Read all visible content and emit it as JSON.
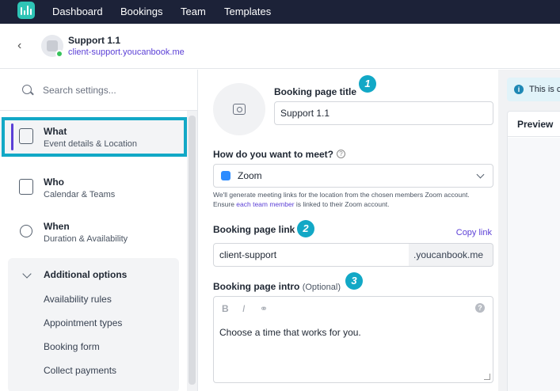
{
  "nav": {
    "items": [
      {
        "label": "Dashboard"
      },
      {
        "label": "Bookings"
      },
      {
        "label": "Team"
      },
      {
        "label": "Templates"
      }
    ]
  },
  "page": {
    "name": "Support 1.1",
    "url": "client-support.youcanbook.me"
  },
  "sidebar": {
    "search_placeholder": "Search settings...",
    "items": [
      {
        "title": "What",
        "subtitle": "Event details & Location",
        "icon": "details-icon",
        "active": true
      },
      {
        "title": "Who",
        "subtitle": "Calendar & Teams",
        "icon": "calendar-icon"
      },
      {
        "title": "When",
        "subtitle": "Duration & Availability",
        "icon": "watch-icon"
      }
    ],
    "additional": {
      "title": "Additional options",
      "items": [
        "Availability rules",
        "Appointment types",
        "Booking form",
        "Collect payments"
      ]
    }
  },
  "form": {
    "title_label": "Booking page title",
    "title_value": "Support 1.1",
    "meet_label": "How do you want to meet?",
    "meet_value": "Zoom",
    "meet_help_1": "We'll generate meeting links for the location from the chosen members Zoom account. Ensure ",
    "meet_help_link": "each team member",
    "meet_help_2": " is linked to their Zoom account.",
    "link_label": "Booking page link",
    "copy_link": "Copy link",
    "link_value": "client-support",
    "link_suffix": ".youcanbook.me",
    "intro_label": "Booking page intro",
    "intro_optional": "(Optional)",
    "intro_toolbar": {
      "bold": "B",
      "italic": "I"
    },
    "intro_value": "Choose a time that works for you."
  },
  "badges": [
    "1",
    "2",
    "3"
  ],
  "right": {
    "info_text": "This is c",
    "preview_label": "Preview"
  },
  "colors": {
    "nav_bg": "#1c2238",
    "accent": "#5b3fd6",
    "highlight": "#12a8c6",
    "logo": "#2ec4b6"
  }
}
